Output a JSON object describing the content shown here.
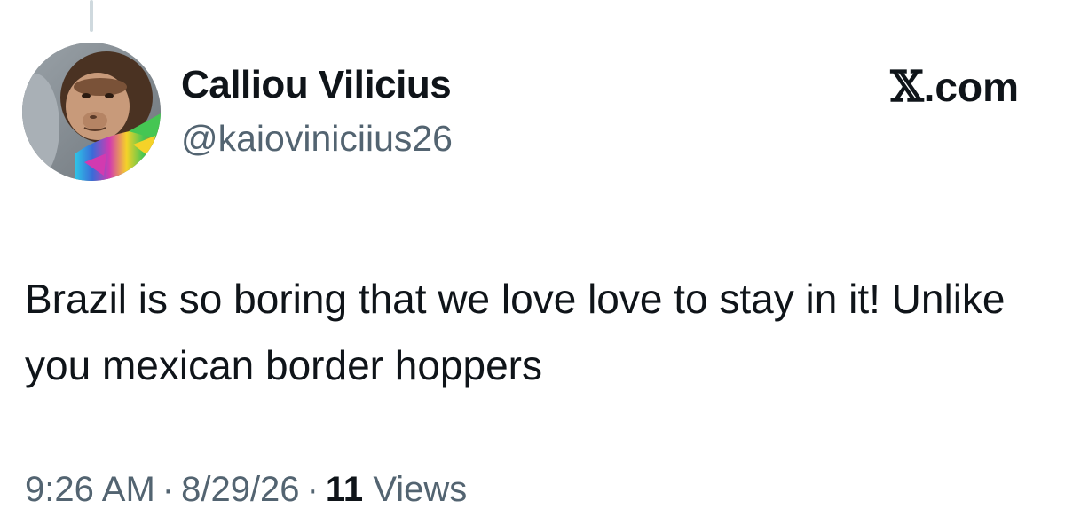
{
  "author": {
    "display_name": "Calliou Vilicius",
    "handle": "@kaioviniciius26",
    "avatar_icon": "capuchin-monkey-avatar"
  },
  "brand": {
    "x_glyph": "𝕏",
    "domain_suffix": ".com"
  },
  "tweet": {
    "text": "Brazil is so boring that we love love to stay in it! Unlike you mexican border hoppers"
  },
  "meta": {
    "time": "9:26 AM",
    "separator": "·",
    "date": "8/29/26",
    "views_count": "11",
    "views_label": "Views"
  },
  "colors": {
    "text_primary": "#0f1419",
    "text_secondary": "#536471",
    "thread_line": "#cfd9de"
  }
}
